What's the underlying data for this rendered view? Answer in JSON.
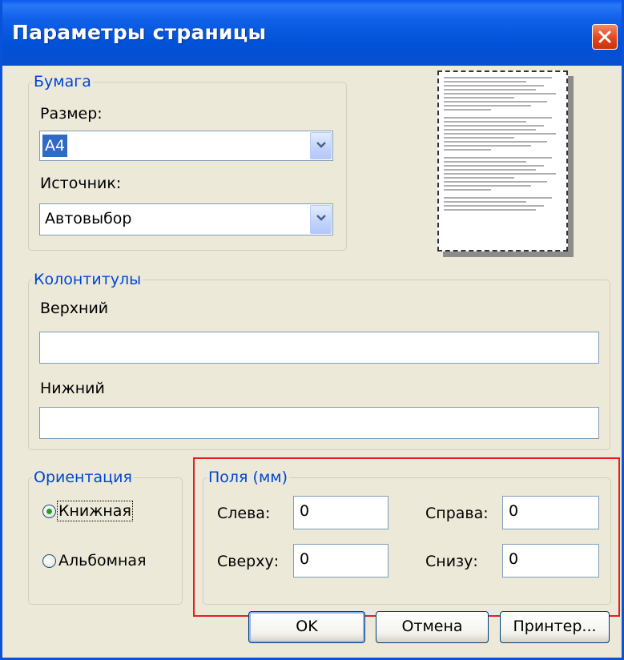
{
  "window": {
    "title": "Параметры страницы"
  },
  "paper": {
    "legend": "Бумага",
    "size_label": "Размер:",
    "size_value": "A4",
    "source_label": "Источник:",
    "source_value": "Автовыбор"
  },
  "headers": {
    "legend": "Колонтитулы",
    "top_label": "Верхний",
    "top_value": "",
    "bottom_label": "Нижний",
    "bottom_value": ""
  },
  "orientation": {
    "legend": "Ориентация",
    "portrait_label": "Книжная",
    "landscape_label": "Альбомная",
    "selected": "portrait"
  },
  "margins": {
    "legend": "Поля (мм)",
    "left_label": "Слева:",
    "left_value": "0",
    "right_label": "Справа:",
    "right_value": "0",
    "top_label": "Сверху:",
    "top_value": "0",
    "bottom_label": "Снизу:",
    "bottom_value": "0"
  },
  "buttons": {
    "ok": "OK",
    "cancel": "Отмена",
    "printer": "Принтер..."
  },
  "colors": {
    "titlebar": "#0151d6",
    "dialog_bg": "#ece9d8",
    "group_legend": "#0046d5",
    "highlight": "#e81e1e",
    "selection": "#316ac5"
  },
  "icons": {
    "close": "close-icon",
    "dropdown": "chevron-down-icon",
    "preview": "page-preview-icon"
  }
}
